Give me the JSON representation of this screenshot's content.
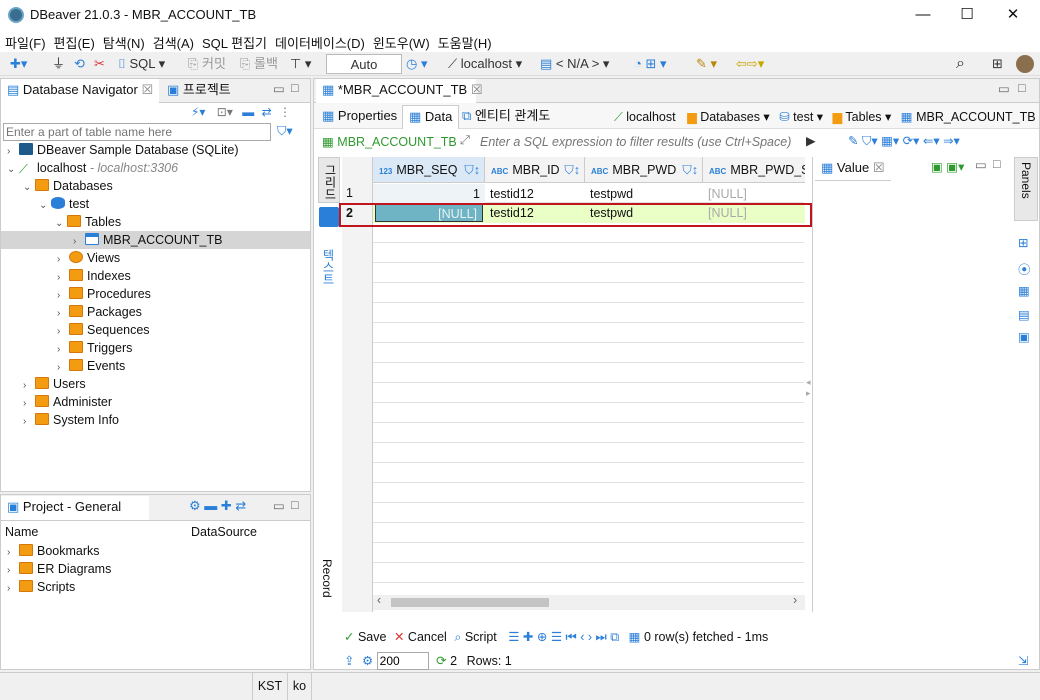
{
  "window": {
    "title": "DBeaver 21.0.3 - MBR_ACCOUNT_TB",
    "minimize": "—",
    "maximize": "☐",
    "close": "✕"
  },
  "menu": [
    "파일(F)",
    "편집(E)",
    "탐색(N)",
    "검색(A)",
    "SQL 편집기",
    "데이터베이스(D)",
    "윈도우(W)",
    "도움말(H)"
  ],
  "toolbar": {
    "sql": "SQL",
    "commit": "커밋",
    "rollback": "롤백",
    "mode": "Auto",
    "connection": "localhost",
    "schema": "< N/A >"
  },
  "navigator": {
    "tab_label": "Database Navigator",
    "project_tab": "프로젝트",
    "filter_placeholder": "Enter a part of table name here",
    "nodes": [
      {
        "label": "DBeaver Sample Database (SQLite)"
      },
      {
        "label": "localhost",
        "suffix": " - localhost:3306"
      },
      {
        "label": "Databases"
      },
      {
        "label": "test"
      },
      {
        "label": "Tables"
      },
      {
        "label": "MBR_ACCOUNT_TB"
      },
      {
        "label": "Views"
      },
      {
        "label": "Indexes"
      },
      {
        "label": "Procedures"
      },
      {
        "label": "Packages"
      },
      {
        "label": "Sequences"
      },
      {
        "label": "Triggers"
      },
      {
        "label": "Events"
      },
      {
        "label": "Users"
      },
      {
        "label": "Administer"
      },
      {
        "label": "System Info"
      }
    ]
  },
  "project": {
    "tab_label": "Project - General",
    "col_name": "Name",
    "col_source": "DataSource",
    "items": [
      "Bookmarks",
      "ER Diagrams",
      "Scripts"
    ]
  },
  "editor": {
    "tab_label": "*MBR_ACCOUNT_TB",
    "subtabs": [
      "Properties",
      "Data",
      "엔티티 관계도"
    ],
    "breadcrumb": [
      "localhost",
      "Databases",
      "test",
      "Tables",
      "MBR_ACCOUNT_TB"
    ],
    "filter_table": "MBR_ACCOUNT_TB",
    "filter_placeholder": "Enter a SQL expression to filter results (use Ctrl+Space)",
    "side_tabs": {
      "grid": "그리드",
      "text": "텍스트",
      "record": "Record"
    },
    "columns": [
      {
        "type": "123",
        "name": "MBR_SEQ"
      },
      {
        "type": "ABC",
        "name": "MBR_ID"
      },
      {
        "type": "ABC",
        "name": "MBR_PWD"
      },
      {
        "type": "ABC",
        "name": "MBR_PWD_SA"
      }
    ],
    "rows": [
      {
        "num": "1",
        "cells": [
          "1",
          "testid12",
          "testpwd",
          "[NULL]"
        ]
      },
      {
        "num": "2",
        "cells": [
          "[NULL]",
          "testid12",
          "testpwd",
          "[NULL]"
        ]
      }
    ],
    "value_panel": "Value",
    "panels_label": "Panels",
    "actions": {
      "save": "Save",
      "cancel": "Cancel",
      "script": "Script",
      "fetched": "0 row(s) fetched - 1ms"
    },
    "fetch_size": "200",
    "refresh_count": "2",
    "rows_label": "Rows: 1"
  },
  "status": {
    "tz": "KST",
    "locale": "ko"
  },
  "colors": {
    "accent": "#2a7fd8",
    "new_row": "#eaffc6",
    "selected_cell": "#6eb4c4",
    "highlight_border": "#c0141e"
  }
}
